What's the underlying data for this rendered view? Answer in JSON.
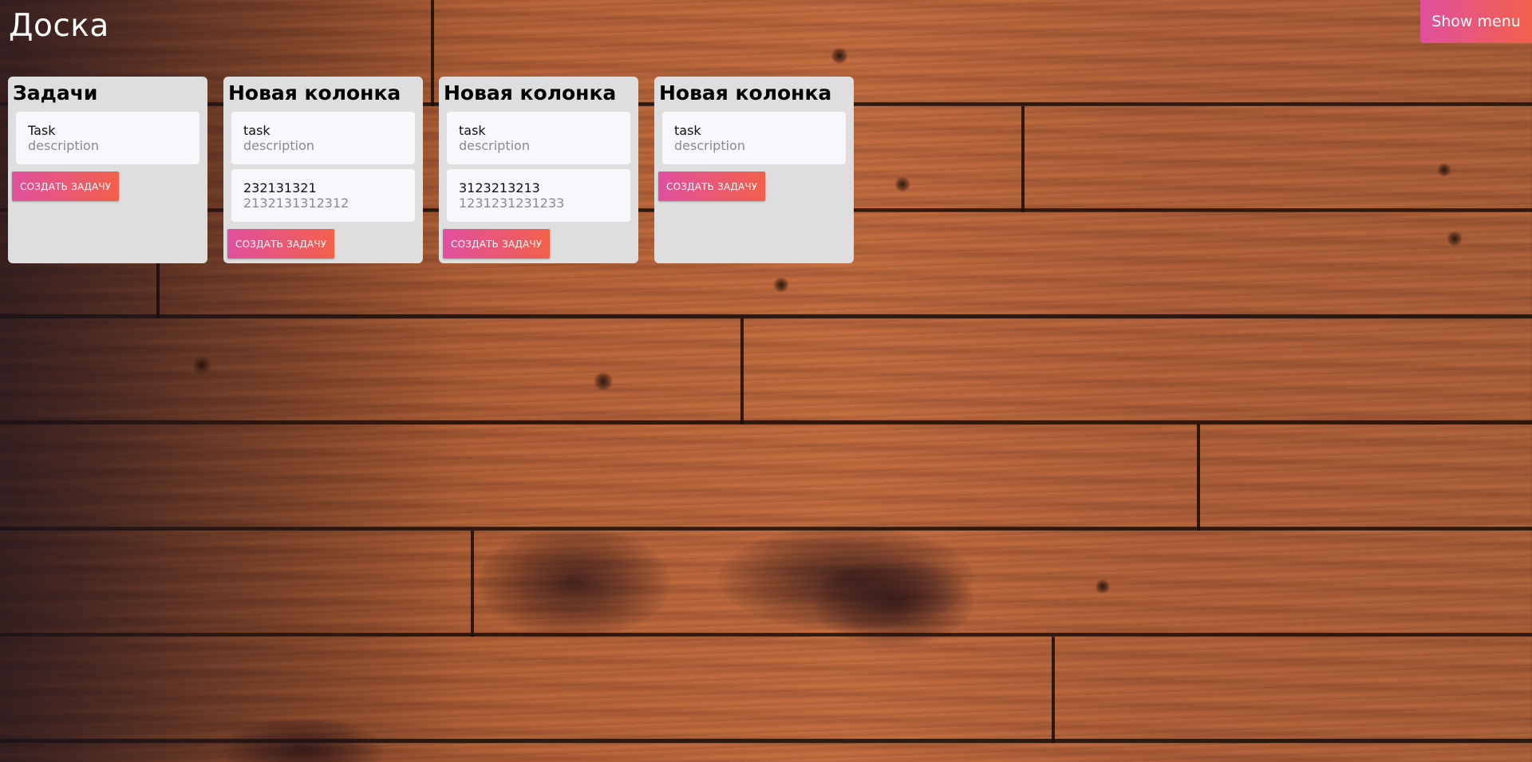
{
  "header": {
    "title": "Доска",
    "menu_button_label": "Show menu"
  },
  "board": {
    "columns": [
      {
        "title": "Задачи",
        "tasks": [
          {
            "title": "Task",
            "description": "description"
          }
        ],
        "create_button_label": "СОЗДАТЬ ЗАДАЧУ"
      },
      {
        "title": "Новая колонка",
        "tasks": [
          {
            "title": "task",
            "description": "description"
          },
          {
            "title": "232131321",
            "description": "2132131312312"
          }
        ],
        "create_button_label": "СОЗДАТЬ ЗАДАЧУ"
      },
      {
        "title": "Новая колонка",
        "tasks": [
          {
            "title": "task",
            "description": "description"
          },
          {
            "title": "3123213213",
            "description": "1231231231233"
          }
        ],
        "create_button_label": "СОЗДАТЬ ЗАДАЧУ"
      },
      {
        "title": "Новая колонка",
        "tasks": [
          {
            "title": "task",
            "description": "description"
          }
        ],
        "create_button_label": "СОЗДАТЬ ЗАДАЧУ"
      }
    ]
  },
  "colors": {
    "accent_gradient_start": "#e0509e",
    "accent_gradient_end": "#f2604a",
    "column_background": "#dedede",
    "card_background": "#f7f8fc"
  }
}
